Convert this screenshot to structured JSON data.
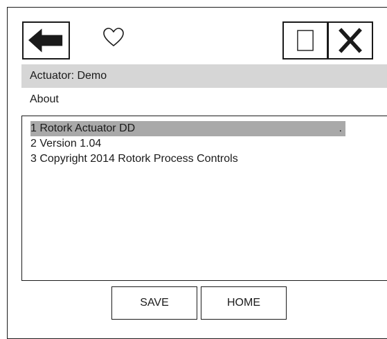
{
  "header": {
    "back_icon": "left-arrow-icon",
    "favorite_icon": "heart-outline-icon",
    "window_icon": "square-outline-icon",
    "close_icon": "close-x-icon",
    "title": "Actuator: Demo"
  },
  "section": {
    "label": "About"
  },
  "list": {
    "items": [
      {
        "label": "1 Rotork Actuator DD",
        "suffix": "."
      },
      {
        "label": "2 Version 1.04"
      },
      {
        "label": "3 Copyright 2014 Rotork Process Controls"
      }
    ],
    "selected_index": 0
  },
  "footer": {
    "save_label": "SAVE",
    "home_label": "HOME"
  },
  "colors": {
    "title_bar_bg": "#d6d6d6",
    "selected_row_bg": "#a9a9a9",
    "ink": "#1a1a1a"
  }
}
